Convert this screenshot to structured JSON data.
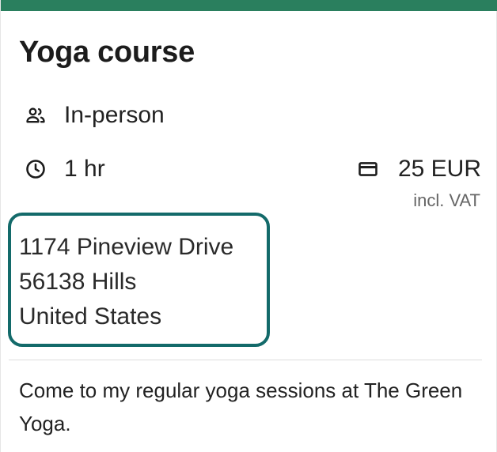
{
  "card": {
    "title": "Yoga course",
    "format": {
      "icon": "people-icon",
      "label": "In-person"
    },
    "duration": {
      "icon": "clock-icon",
      "label": "1 hr"
    },
    "price": {
      "icon": "credit-card-icon",
      "label": "25 EUR",
      "note": "incl. VAT"
    },
    "address": {
      "street": "1174 Pineview Drive",
      "city": "56138 Hills",
      "country": "United States"
    },
    "description": "Come to my regular yoga sessions at The Green Yoga."
  },
  "colors": {
    "accent_bar": "#2a7f5e",
    "focus_ring": "#136a6a"
  }
}
